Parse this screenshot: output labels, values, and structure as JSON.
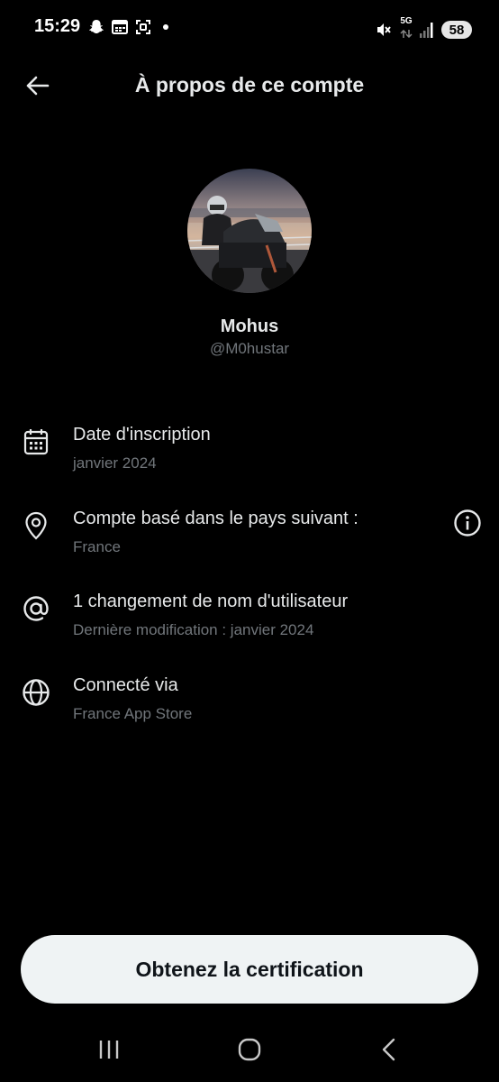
{
  "status_bar": {
    "time": "15:29",
    "network": "5G",
    "battery": "58",
    "left_icons": [
      "snapchat-icon",
      "calendar-icon",
      "screenshot-icon"
    ],
    "right_icons": [
      "mute-icon",
      "network-5g-icon",
      "signal-icon",
      "battery-icon"
    ]
  },
  "header": {
    "title": "À propos de ce compte",
    "back_icon": "arrow-left-icon"
  },
  "profile": {
    "name": "Mohus",
    "handle": "@M0hustar"
  },
  "info": [
    {
      "title": "Date d'inscription",
      "subtitle": "janvier 2024",
      "icon": "calendar-icon"
    },
    {
      "title": "Compte basé dans le pays suivant :",
      "subtitle": "France",
      "icon": "location-pin-icon",
      "extra_icon": "info-icon"
    },
    {
      "title": "1 changement de nom d'utilisateur",
      "subtitle": "Dernière modification : janvier 2024",
      "icon": "at-sign-icon"
    },
    {
      "title": "Connecté via",
      "subtitle": "France App Store",
      "icon": "globe-icon"
    }
  ],
  "cta": {
    "label": "Obtenez la certification"
  },
  "colors": {
    "background": "#000000",
    "primary_text": "#e7e9ea",
    "secondary_text": "#71767b",
    "button_bg": "#eff3f4",
    "button_text": "#0f1419"
  }
}
